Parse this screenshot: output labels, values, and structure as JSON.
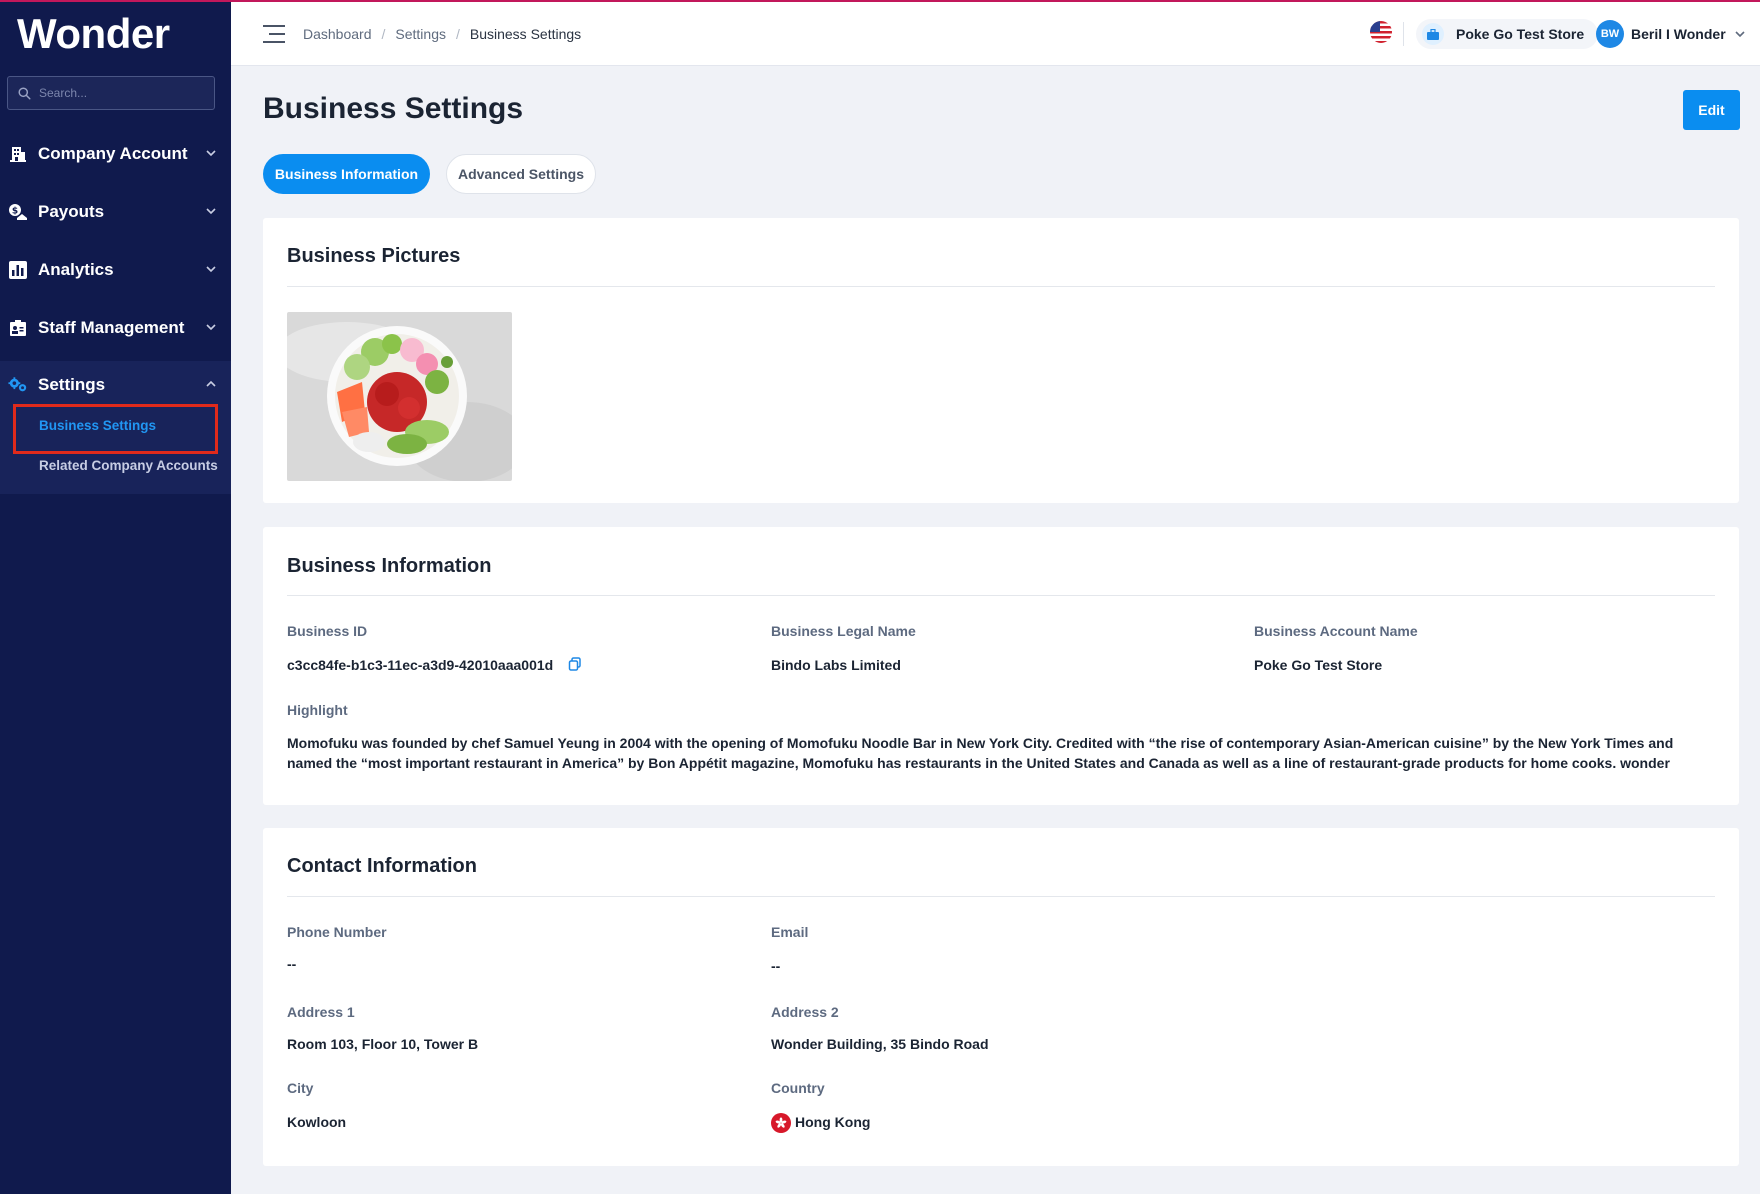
{
  "sidebar": {
    "logo": "Wonder",
    "search_placeholder": "Search...",
    "items": [
      {
        "label": "Company Account"
      },
      {
        "label": "Payouts"
      },
      {
        "label": "Analytics"
      },
      {
        "label": "Staff Management"
      },
      {
        "label": "Settings"
      }
    ],
    "settings_sub": [
      {
        "label": "Business Settings",
        "active": true
      },
      {
        "label": "Related Company Accounts",
        "active": false
      }
    ]
  },
  "header": {
    "breadcrumb": [
      "Dashboard",
      "Settings",
      "Business Settings"
    ],
    "store_name": "Poke Go Test Store",
    "user_initials": "BW",
    "user_name": "Beril I Wonder"
  },
  "page": {
    "title": "Business Settings",
    "edit_label": "Edit",
    "tabs": [
      {
        "label": "Business Information",
        "active": true
      },
      {
        "label": "Advanced Settings",
        "active": false
      }
    ]
  },
  "business_pictures": {
    "title": "Business Pictures"
  },
  "business_information": {
    "title": "Business Information",
    "business_id_label": "Business ID",
    "business_id": "c3cc84fe-b1c3-11ec-a3d9-42010aaa001d",
    "legal_name_label": "Business Legal Name",
    "legal_name": "Bindo Labs Limited",
    "account_name_label": "Business Account Name",
    "account_name": "Poke Go Test Store",
    "highlight_label": "Highlight",
    "highlight": "Momofuku was founded by chef Samuel Yeung in 2004 with the opening of Momofuku Noodle Bar in New York City. Credited with “the rise of contemporary Asian-American cuisine” by the New York Times and named the “most important restaurant in America” by Bon Appétit magazine, Momofuku has restaurants in the United States and Canada as well as a line of restaurant-grade products for home cooks. wonder"
  },
  "contact_information": {
    "title": "Contact Information",
    "phone_label": "Phone Number",
    "phone": "--",
    "email_label": "Email",
    "email": "--",
    "address1_label": "Address 1",
    "address1": "Room 103, Floor 10, Tower B",
    "address2_label": "Address 2",
    "address2": "Wonder Building, 35 Bindo Road",
    "city_label": "City",
    "city": "Kowloon",
    "country_label": "Country",
    "country": "Hong Kong"
  },
  "colors": {
    "sidebar_bg": "#101a4d",
    "accent": "#0a8df0",
    "highlight_box": "#e02a1b"
  },
  "icons": {
    "company_account": "building-icon",
    "payouts": "payout-icon",
    "analytics": "bar-chart-icon",
    "staff": "staff-icon",
    "settings": "gears-icon",
    "copy": "copy-icon"
  }
}
